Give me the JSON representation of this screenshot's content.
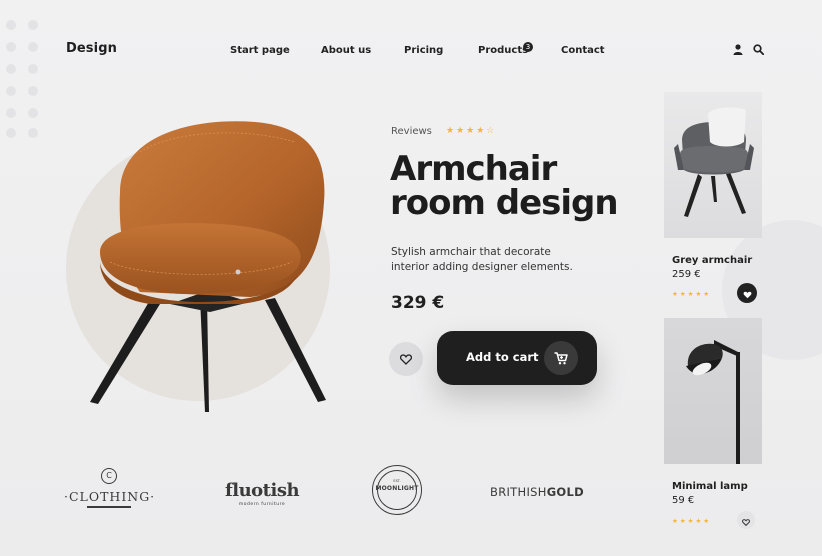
{
  "header": {
    "brand": "Design",
    "nav": [
      {
        "label": "Start page"
      },
      {
        "label": "About us"
      },
      {
        "label": "Pricing"
      },
      {
        "label": "Products",
        "badge": "3"
      },
      {
        "label": "Contact"
      }
    ],
    "icons": [
      "user-icon",
      "search-icon"
    ]
  },
  "hero": {
    "reviews_label": "Reviews",
    "rating": 4,
    "rating_max": 5,
    "title_line1": "Armchair",
    "title_line2": "room design",
    "description": "Stylish armchair that decorate interior adding designer elements.",
    "price": "329 €",
    "add_to_cart_label": "Add to cart"
  },
  "products": [
    {
      "name": "Grey armchair",
      "price": "259 €",
      "rating": 4,
      "favorited": true
    },
    {
      "name": "Minimal lamp",
      "price": "59 €",
      "rating": 4,
      "favorited": false
    }
  ],
  "brands": {
    "clothing": {
      "mark": "C",
      "name": "·CLOTHING·"
    },
    "fluotish": {
      "name": "fluotish",
      "tagline": "modern furniture"
    },
    "moonlight": {
      "name": "MOONLIGHT",
      "small": "EST."
    },
    "british": {
      "part1": "BRITHISH",
      "part2": "GOLD"
    }
  },
  "colors": {
    "accent_star": "#f0b73a",
    "dark": "#1f1f1f",
    "leather": "#b5652a"
  }
}
